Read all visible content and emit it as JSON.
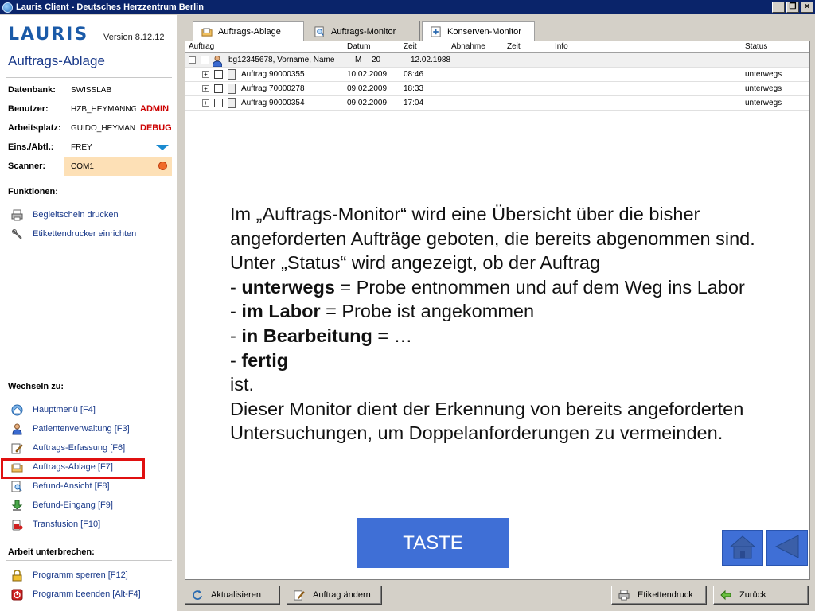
{
  "window": {
    "title": "Lauris Client - Deutsches Herzzentrum Berlin",
    "minimize": "_",
    "restore": "❐",
    "close": "×"
  },
  "sidebar": {
    "logo": "LAURIS",
    "version": "Version 8.12.12",
    "page_title": "Auftrags-Ablage",
    "info": {
      "datenbank_label": "Datenbank:",
      "datenbank_value": "SWISSLAB",
      "benutzer_label": "Benutzer:",
      "benutzer_value": "HZB_HEYMANNG",
      "benutzer_tag": "ADMIN",
      "arbeitsplatz_label": "Arbeitsplatz:",
      "arbeitsplatz_value": "GUIDO_HEYMAN",
      "arbeitsplatz_tag": "DEBUG",
      "eins_label": "Eins./Abtl.:",
      "eins_value": "FREY",
      "scanner_label": "Scanner:",
      "scanner_value": "COM1"
    },
    "funktionen_heading": "Funktionen:",
    "funktionen": [
      {
        "label": "Begleitschein drucken",
        "icon": "printer-icon"
      },
      {
        "label": "Etikettendrucker einrichten",
        "icon": "wrench-icon"
      }
    ],
    "wechseln_heading": "Wechseln zu:",
    "wechseln": [
      {
        "label": "Hauptmenü [F4]",
        "icon": "home-icon"
      },
      {
        "label": "Patientenverwaltung [F3]",
        "icon": "person-icon"
      },
      {
        "label": "Auftrags-Erfassung [F6]",
        "icon": "edit-icon"
      },
      {
        "label": "Auftrags-Ablage [F7]",
        "icon": "folder-icon"
      },
      {
        "label": "Befund-Ansicht [F8]",
        "icon": "magnifier-icon"
      },
      {
        "label": "Befund-Eingang [F9]",
        "icon": "download-icon"
      },
      {
        "label": "Transfusion [F10]",
        "icon": "blood-bag-icon"
      }
    ],
    "unterbrechen_heading": "Arbeit unterbrechen:",
    "unterbrechen": [
      {
        "label": "Programm sperren [F12]",
        "icon": "lock-icon"
      },
      {
        "label": "Programm beenden [Alt-F4]",
        "icon": "power-icon"
      }
    ]
  },
  "tabs": [
    {
      "label": "Auftrags-Ablage",
      "icon": "folder-icon"
    },
    {
      "label": "Auftrags-Monitor",
      "icon": "monitor-icon"
    },
    {
      "label": "Konserven-Monitor",
      "icon": "plus-doc-icon"
    }
  ],
  "grid": {
    "headers": {
      "auftrag": "Auftrag",
      "datum": "Datum",
      "zeit": "Zeit",
      "abnahme": "Abnahme",
      "zeit2": "Zeit",
      "info": "Info",
      "status": "Status"
    },
    "patient": {
      "id": "bg12345678, Vorname, Name",
      "sex": "M",
      "age": "20",
      "dob": "12.02.1988"
    },
    "rows": [
      {
        "auftrag": "Auftrag 90000355",
        "datum": "10.02.2009",
        "zeit": "08:46",
        "status": "unterwegs"
      },
      {
        "auftrag": "Auftrag 70000278",
        "datum": "09.02.2009",
        "zeit": "18:33",
        "status": "unterwegs"
      },
      {
        "auftrag": "Auftrag 90000354",
        "datum": "09.02.2009",
        "zeit": "17:04",
        "status": "unterwegs"
      }
    ]
  },
  "callout": {
    "line1": "Im „Auftrags-Monitor“ wird eine Übersicht über die bisher",
    "line2": "angeforderten Aufträge geboten, die bereits abgenommen sind.",
    "line3": "Unter „Status“ wird angezeigt, ob der Auftrag",
    "s1_bold": "unterwegs",
    "s1_rest": " = Probe entnommen und auf dem Weg ins Labor",
    "s2_bold": "im Labor",
    "s2_rest": " = Probe ist angekommen",
    "s3_bold": "in Bearbeitung",
    "s3_rest": " = …",
    "s4_bold": "fertig",
    "dash": "- ",
    "line_ist": "ist.",
    "line4": "Dieser Monitor dient der Erkennung von bereits angeforderten",
    "line5": "Untersuchungen, um Doppelanforderungen zu vermeinden."
  },
  "taste_label": "TASTE",
  "buttons": {
    "aktualisieren": "Aktualisieren",
    "auftrag_aendern": "Auftrag ändern",
    "etikettendruck": "Etikettendruck",
    "zurueck": "Zurück"
  },
  "colors": {
    "accent_blue": "#3f6fd6",
    "highlight_red": "#e01010",
    "tag_red": "#cc0000",
    "scanner_bg": "#fde0b6"
  }
}
